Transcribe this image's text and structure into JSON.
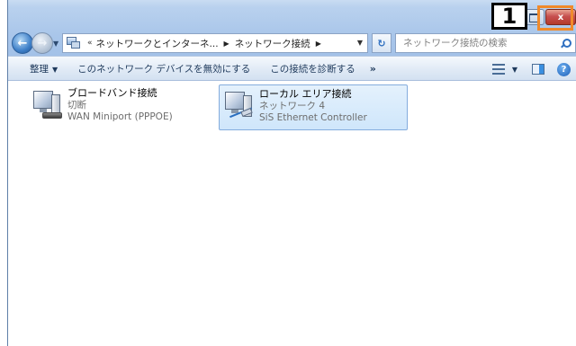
{
  "window": {
    "close_glyph": "x"
  },
  "annotation": {
    "marker_number": "1",
    "highlight_color": "#f08a2b"
  },
  "navigation": {
    "back_glyph": "←",
    "forward_glyph": "→",
    "dropdown_glyph": "▼"
  },
  "address": {
    "overflow": "«",
    "crumbs": [
      "ネットワークとインターネ...",
      "ネットワーク接続"
    ],
    "separator": "▶",
    "dropdown_glyph": "▼"
  },
  "search": {
    "placeholder": "ネットワーク接続の検索",
    "icon": "search-icon"
  },
  "toolbar": {
    "organize_label": "整理",
    "disable_label": "このネットワーク デバイスを無効にする",
    "diagnose_label": "この接続を診断する",
    "more_label": "»",
    "dropdown_glyph": "▼",
    "help_label": "?"
  },
  "connections": [
    {
      "name": "ブロードバンド接続",
      "status": "切断",
      "device": "WAN Miniport (PPPOE)",
      "icon": "broadband-connection-icon",
      "selected": false
    },
    {
      "name": "ローカル エリア接続",
      "status": "ネットワーク 4",
      "device": "SiS Ethernet Controller",
      "icon": "local-area-connection-icon",
      "selected": true
    }
  ],
  "colors": {
    "close_button": "#c75050",
    "selection": "#cfe6fb",
    "accent": "#2f6fc0"
  }
}
